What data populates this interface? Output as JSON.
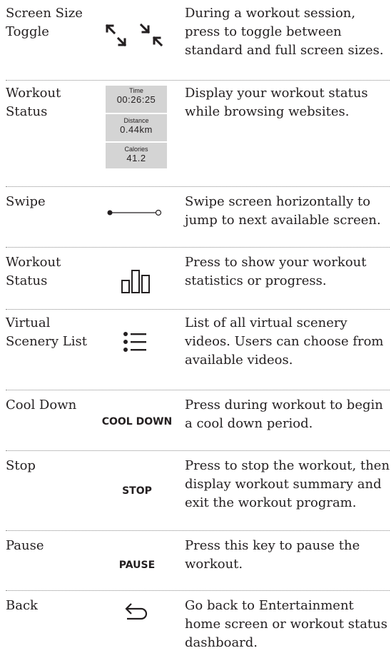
{
  "rows": [
    {
      "name": "Screen Size\nToggle",
      "desc": "During a workout session, press to toggle between standard and full screen sizes.",
      "icon": "screen-size-toggle-icon"
    },
    {
      "name": "Workout\nStatus",
      "desc": "Display your workout status while browsing websites.",
      "icon": "workout-status-panel"
    },
    {
      "name": "Swipe",
      "desc": "Swipe screen horizontally to jump to next available screen.",
      "icon": "swipe-icon"
    },
    {
      "name": "Workout\nStatus",
      "desc": "Press to show your workout statistics or progress.",
      "icon": "bar-chart-icon"
    },
    {
      "name": "Virtual\nScenery List",
      "desc": "List of all virtual scenery videos.  Users can choose from available videos.",
      "icon": "list-icon"
    },
    {
      "name": "Cool Down",
      "desc": "Press during workout to begin a cool down period.",
      "button": "COOL DOWN"
    },
    {
      "name": "Stop",
      "desc": "Press to stop the workout, then display workout summary and exit the workout program.",
      "button": "STOP"
    },
    {
      "name": "Pause",
      "desc": "Press this key to pause the workout.",
      "button": "PAUSE"
    },
    {
      "name": "Back",
      "desc": "Go back to Entertainment home screen or workout status dashboard.",
      "icon": "back-arrow-icon"
    }
  ],
  "workout_panel": {
    "time_label": "Time",
    "time_value": "00:26:25",
    "distance_label": "Distance",
    "distance_value": "0.44km",
    "calories_label": "Calories",
    "calories_value": "41.2",
    "background": "#d4d4d4"
  }
}
